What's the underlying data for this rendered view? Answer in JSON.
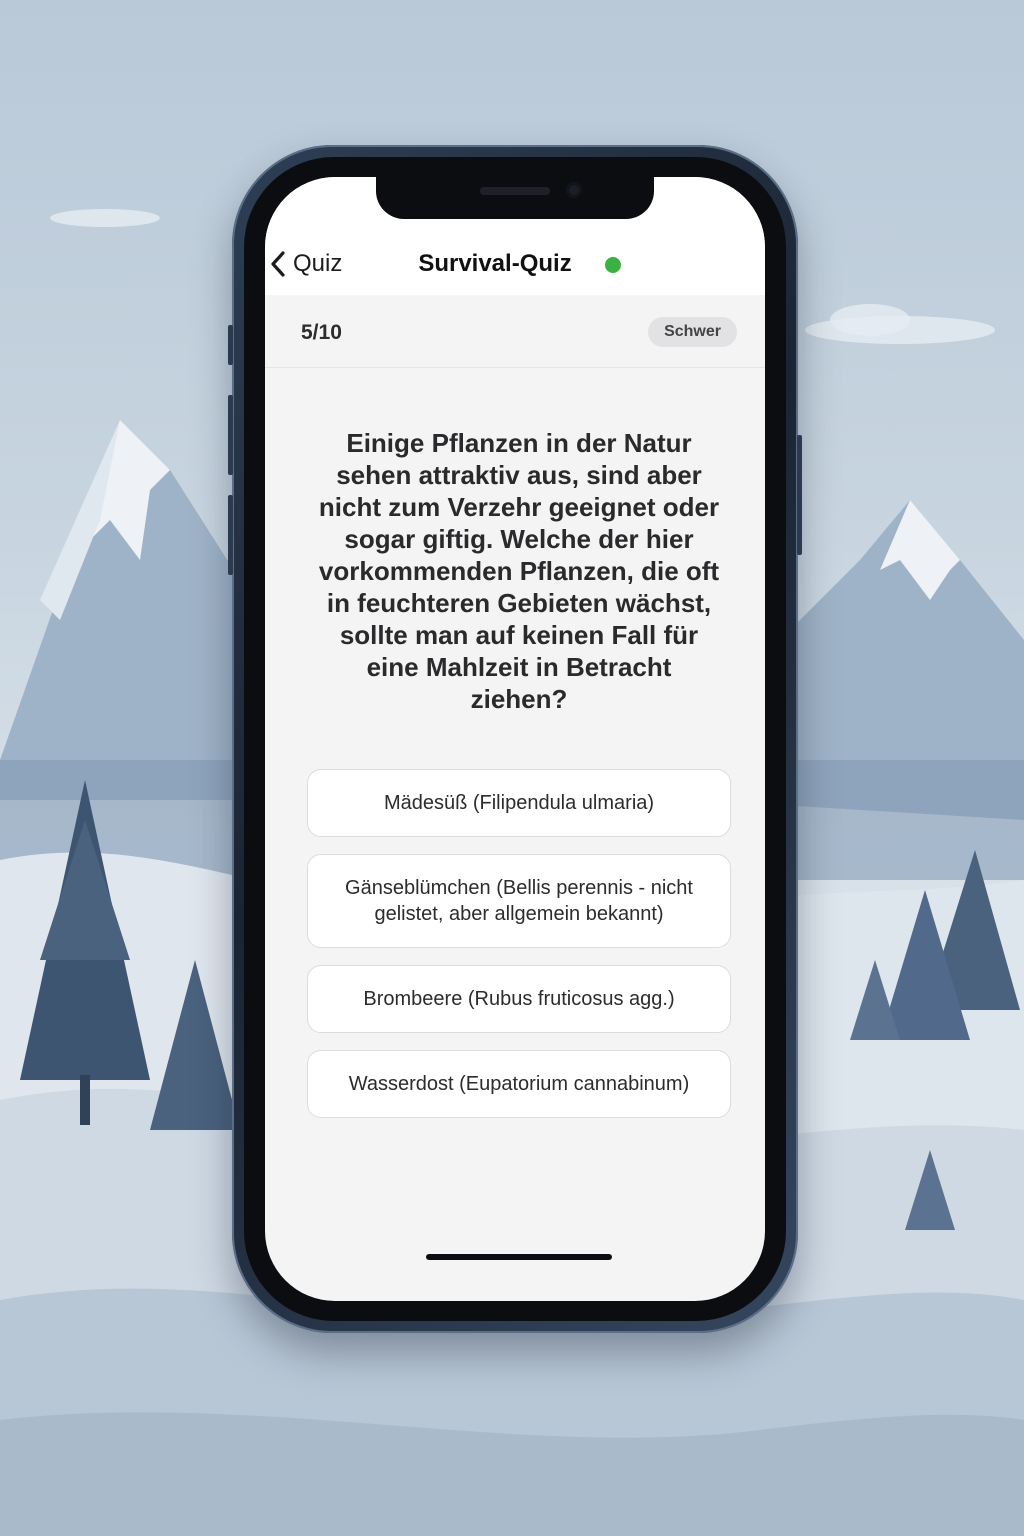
{
  "nav": {
    "back_label": "Quiz",
    "title": "Survival-Quiz",
    "status_color": "#3cb043"
  },
  "progress": {
    "current": 5,
    "total": 10,
    "label": "5/10",
    "difficulty": "Schwer"
  },
  "question": {
    "text": "Einige Pflanzen in der Natur sehen attraktiv aus, sind aber nicht zum Verzehr geeignet oder sogar giftig. Welche der hier vorkommenden Pflanzen, die oft in feuchteren Gebieten wächst, sollte man auf keinen Fall für eine Mahlzeit in Betracht ziehen?"
  },
  "answers": [
    {
      "label": "Mädesüß (Filipendula ulmaria)"
    },
    {
      "label": "Gänseblümchen (Bellis perennis - nicht gelistet, aber allgemein bekannt)"
    },
    {
      "label": "Brombeere (Rubus fruticosus agg.)"
    },
    {
      "label": "Wasserdost (Eupatorium cannabinum)"
    }
  ],
  "icons": {
    "back": "chevron-left-icon"
  }
}
